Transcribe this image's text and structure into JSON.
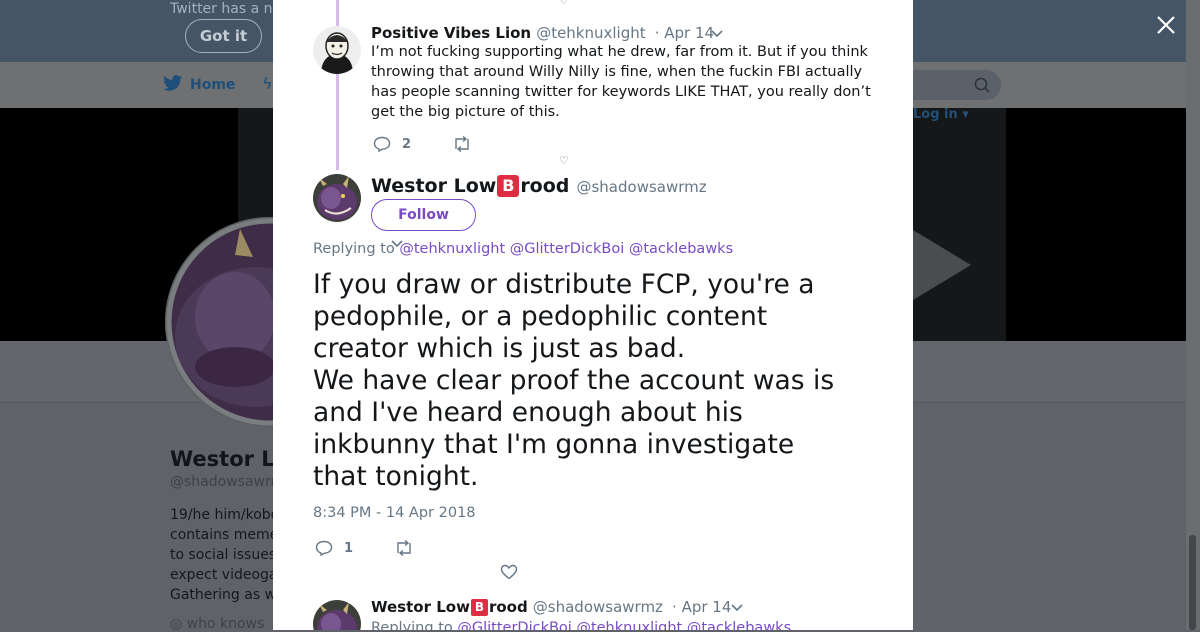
{
  "background": {
    "banner_text": "Twitter has a n",
    "got_it_label": "Got it",
    "nav_home": "Home",
    "login_label": "Log in",
    "profile_name": "Westor L",
    "profile_handle": "@shadowsawrm",
    "bio_lines": [
      "19/he him/kobo",
      "contains meme",
      "to social issues",
      "expect videoga",
      "Gathering as w"
    ],
    "location": "who knows"
  },
  "modal": {
    "previous_tweet": {
      "name": "Positive Vibes Lion",
      "handle": "@tehknuxlight",
      "date": "· Apr 14",
      "lines": [
        "I’m not fucking supporting what he drew, far from it. But if you think",
        "throwing that around Willy Nilly is fine, when the fuckin FBI actually",
        "has people scanning twitter for keywords LIKE THAT, you really don’t",
        "get the big picture of this."
      ],
      "reply_count": "2"
    },
    "main_tweet": {
      "name_before": "Westor Low",
      "name_emoji": "B",
      "name_after": "rood",
      "handle": "@shadowsawrmz",
      "follow_label": "Follow",
      "replying_prefix": "Replying to",
      "mentions": [
        "@tehknuxlight",
        "@GlitterDickBoi",
        "@tacklebawks"
      ],
      "text_lines": [
        "If you draw or distribute FCP, you're a",
        "pedophile, or a pedophilic content",
        "creator which is just as bad.",
        "We have clear proof the account was is",
        "and I've heard enough about his",
        "inkbunny that I'm gonna investigate",
        "that tonight."
      ],
      "timestamp": "8:34 PM - 14 Apr 2018",
      "reply_count": "1"
    },
    "next_tweet": {
      "name_before": "Westor Low",
      "name_emoji": "B",
      "name_after": "rood",
      "handle": "@shadowsawrmz",
      "date": "· Apr 14",
      "replying_prefix": "Replying to",
      "mentions": [
        "@GlitterDickBoi",
        "@tehknuxlight",
        "@tacklebawks"
      ]
    }
  },
  "colors": {
    "accent": "#794bc4",
    "thread_line": "#d5bde8",
    "muted": "#657786",
    "text": "#14171a"
  },
  "icons": [
    "close-icon",
    "twitter-bird-icon",
    "search-icon",
    "reply-icon",
    "retweet-icon",
    "like-icon",
    "chevron-down-icon",
    "play-icon"
  ]
}
